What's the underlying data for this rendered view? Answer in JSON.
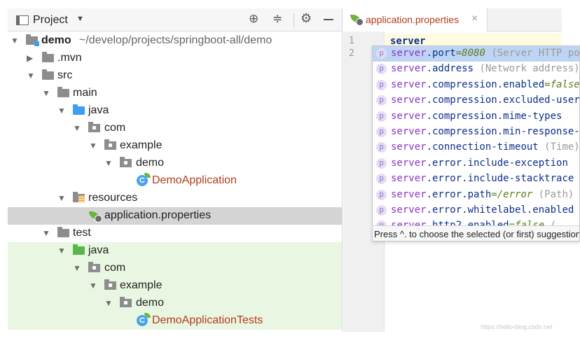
{
  "project_panel": {
    "title": "Project",
    "dropdown": "▼",
    "icons": [
      "project-view-icon",
      "locate-globe-icon",
      "collapse-all-icon",
      "gear-icon",
      "minimize-icon"
    ]
  },
  "tree": {
    "root_name": "demo",
    "root_path": "~/develop/projects/springboot-all/demo",
    "mvn": ".mvn",
    "src": "src",
    "main": "main",
    "main_java": "java",
    "main_com": "com",
    "main_example": "example",
    "main_demo": "demo",
    "main_class": "DemoApplication",
    "resources": "resources",
    "properties": "application.properties",
    "test": "test",
    "test_java": "java",
    "test_com": "com",
    "test_example": "example",
    "test_demo": "demo",
    "test_class": "DemoApplicationTests"
  },
  "editor": {
    "tab_label": "application.properties",
    "tab_close": "×",
    "line_numbers": [
      "1",
      "2"
    ],
    "line1": "server"
  },
  "completion": {
    "badge": "p",
    "items": [
      {
        "match": "server",
        "rest": ".port",
        "value": "=8080",
        "desc": " (Server HTTP port)"
      },
      {
        "match": "server",
        "rest": ".address",
        "value": "",
        "desc": " (Network address)"
      },
      {
        "match": "server",
        "rest": ".compression.enabled",
        "value": "=false",
        "desc": ""
      },
      {
        "match": "server",
        "rest": ".compression.excluded-user-agents",
        "value": "",
        "desc": ""
      },
      {
        "match": "server",
        "rest": ".compression.mime-types",
        "value": "",
        "desc": ""
      },
      {
        "match": "server",
        "rest": ".compression.min-response-size",
        "value": "",
        "desc": ""
      },
      {
        "match": "server",
        "rest": ".connection-timeout",
        "value": "",
        "desc": " (Time)"
      },
      {
        "match": "server",
        "rest": ".error.include-exception",
        "value": "",
        "desc": ""
      },
      {
        "match": "server",
        "rest": ".error.include-stacktrace",
        "value": "",
        "desc": ""
      },
      {
        "match": "server",
        "rest": ".error.path",
        "value": "=/error",
        "desc": " (Path)"
      },
      {
        "match": "server",
        "rest": ".error.whitelabel.enabled",
        "value": "",
        "desc": ""
      },
      {
        "match": "server",
        "rest": ".http2.enabled",
        "value": "=false",
        "desc": " ("
      }
    ],
    "hint": "Press ^. to choose the selected (or first) suggestion"
  },
  "watermark": "https://hello-blog.csdn.net"
}
